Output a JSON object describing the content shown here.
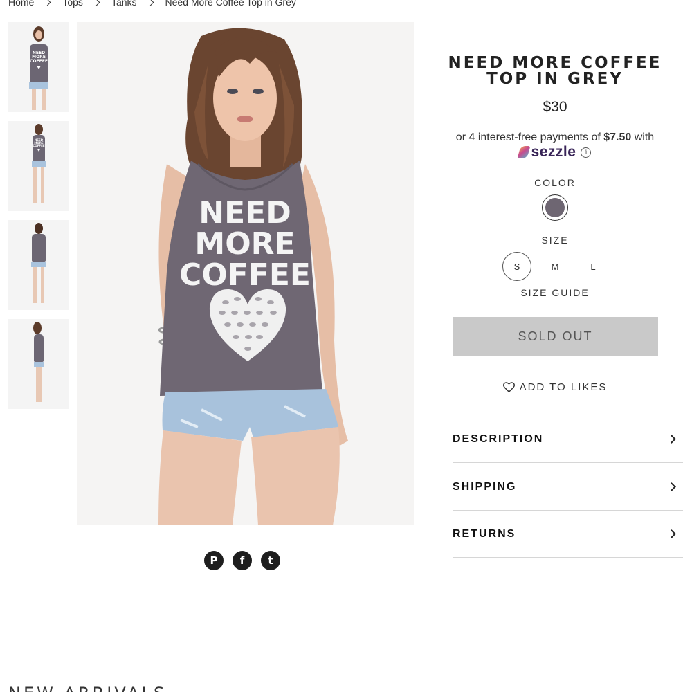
{
  "breadcrumb": [
    "Home",
    "Tops",
    "Tanks",
    "Need More Coffee Top in Grey"
  ],
  "product": {
    "title": "NEED MORE COFFEE TOP IN GREY",
    "price": "$30",
    "shirt_text": [
      "NEED",
      "MORE",
      "COFFEE"
    ],
    "thumb_text": [
      "NEED",
      "MORE",
      "COFFEE"
    ]
  },
  "installments": {
    "prefix": "or 4 interest-free payments of ",
    "amount": "$7.50",
    "suffix": " with",
    "provider": "sezzle",
    "info_icon": "i"
  },
  "color": {
    "label": "COLOR",
    "swatch_hex": "#6e6672"
  },
  "size": {
    "label": "SIZE",
    "options": [
      "S",
      "M",
      "L"
    ],
    "selected": "S",
    "guide": "SIZE GUIDE"
  },
  "buttons": {
    "sold_out": "SOLD OUT",
    "add_to_likes": "ADD TO LIKES"
  },
  "accordion": [
    "DESCRIPTION",
    "SHIPPING",
    "RETURNS"
  ],
  "social": {
    "pinterest": "P",
    "facebook": "f",
    "twitter": "t"
  },
  "section": {
    "new_arrivals": "NEW ARRIVALS"
  },
  "icons": [
    "chevron-right-icon",
    "heart-icon",
    "pinterest-icon",
    "facebook-icon",
    "twitter-icon",
    "info-icon"
  ]
}
